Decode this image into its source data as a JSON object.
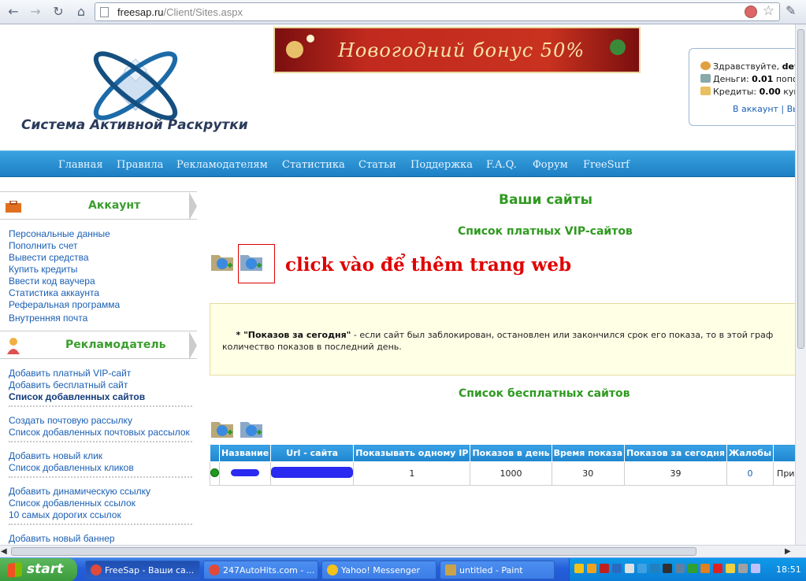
{
  "browser": {
    "url_host": "freesap.ru",
    "url_path": "/Client/Sites.aspx"
  },
  "header": {
    "logo_text": "Система Активной Раскрутки",
    "banner_text": "Новогодний бонус 50%",
    "user": {
      "greeting_label": "Здравствуйте,",
      "greeting_name": "dev",
      "money_label": "Деньги:",
      "money_value": "0.01",
      "money_suffix": "попо",
      "credits_label": "Кредиты:",
      "credits_value": "0.00",
      "credits_suffix": "куп",
      "account_link": "В аккаунт",
      "sep": "|",
      "exit_link": "Вы"
    }
  },
  "nav": [
    "Главная",
    "Правила",
    "Рекламодателям",
    "Статистика",
    "Статьи",
    "Поддержка",
    "F.A.Q.",
    "Форум",
    "FreeSurf"
  ],
  "sidebar": {
    "account_title": "Аккаунт",
    "account_links": [
      "Персональные данные",
      "Пополнить счет",
      "Вывести средства",
      "Купить кредиты",
      "Ввести код ваучера",
      "Статистика аккаунта",
      "Реферальная программа",
      "Внутренняя почта"
    ],
    "advertiser_title": "Рекламодатель",
    "advertiser_links": [
      "Добавить платный VIP-сайт",
      "Добавить бесплатный сайт",
      "Список добавленных сайтов",
      "Создать почтовую рассылку",
      "Список добавленных почтовых рассылок",
      "Добавить новый клик",
      "Список добавленных кликов",
      "Добавить динамическую ссылку",
      "Список добавленных ссылок",
      "10 самых дорогих ссылок",
      "Добавить новый баннер"
    ]
  },
  "main": {
    "title": "Ваши сайты",
    "vip_title": "Список платных VIP-сайтов",
    "annotation": "click vào để thêm trang web",
    "note_lead": "* \"Показов за сегодня\"",
    "note_rest": " - если сайт был заблокирован, остановлен или закончился срок его показа, то в этой граф",
    "note_line2": "количество показов в последний день.",
    "free_title": "Список бесплатных сайтов",
    "table": {
      "headers": [
        "",
        "Название",
        "Url - сайта",
        "Показывать одному IP",
        "Показов в день",
        "Время показа",
        "Показов за сегодня",
        "Жалобы",
        ""
      ],
      "row": [
        "",
        "",
        "",
        "1",
        "1000",
        "30",
        "39",
        "0",
        "Приостан"
      ]
    }
  },
  "taskbar": {
    "start": "start",
    "tasks": [
      "FreeSap - Ваши са...",
      "247AutoHits.com - ...",
      "Yahoo! Messenger",
      "untitled - Paint"
    ],
    "clock": "18:51"
  }
}
